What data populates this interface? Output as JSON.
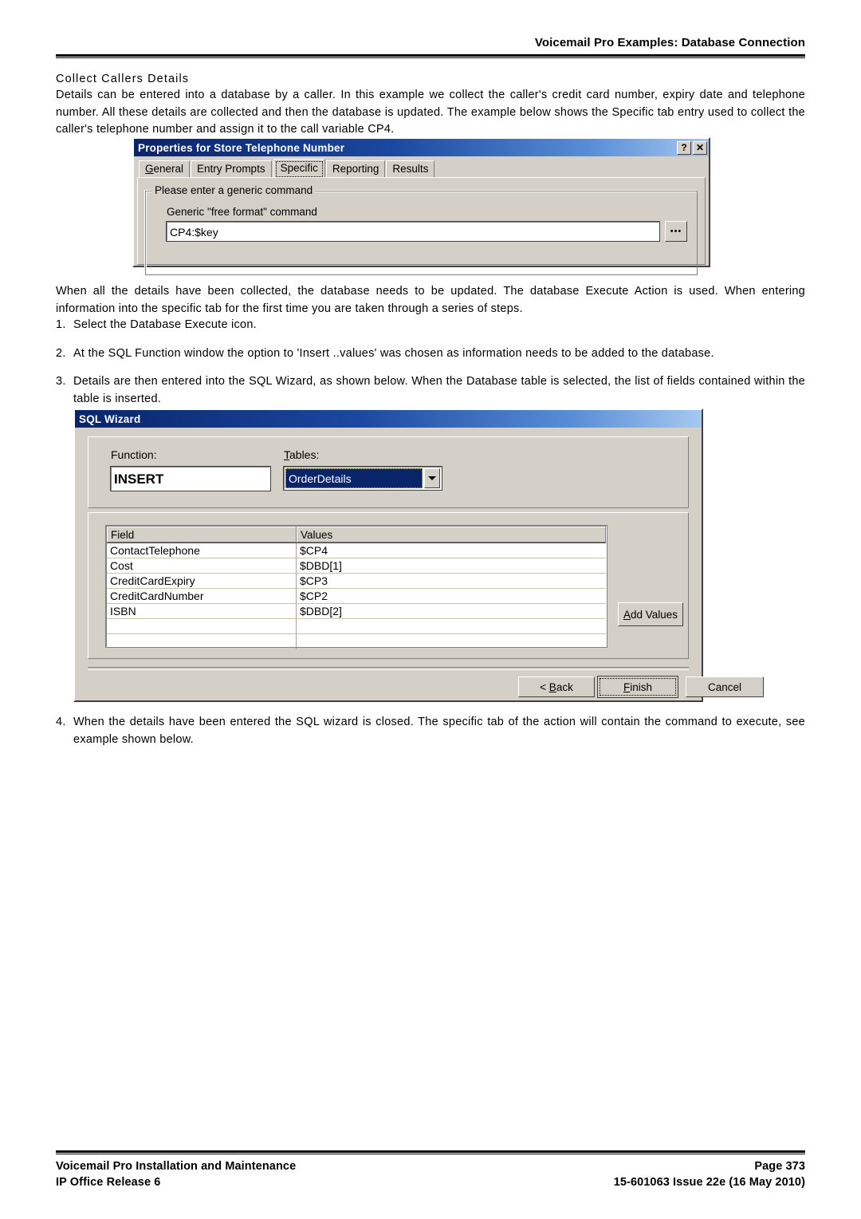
{
  "header": {
    "title": "Voicemail Pro Examples: Database Connection"
  },
  "section": {
    "heading": "Collect Callers Details",
    "intro": "Details can be entered into a database by a caller. In this example we collect the caller's credit card number, expiry date and telephone number. All these details are collected and then the database is updated. The example below shows the Specific tab entry used to collect the caller's telephone number and assign it to the call variable CP4.",
    "after_first_dialog": "When all the details have been collected, the database needs to be updated. The database Execute Action is used. When entering information into the specific tab for the first time you are taken through a series of steps.",
    "steps": [
      {
        "num": "1.",
        "text": "Select the Database Execute icon."
      },
      {
        "num": "2.",
        "text": "At the SQL Function window the option to 'Insert ..values' was chosen as information needs to be added to the database."
      },
      {
        "num": "3.",
        "text": "Details are then entered into the SQL Wizard, as shown below. When the Database table is selected, the list of fields contained within the table is inserted."
      }
    ],
    "step4": {
      "num": "4.",
      "text": "When the details have been entered the SQL wizard is closed. The specific tab of the action will contain the command to execute, see example shown below."
    }
  },
  "properties_dialog": {
    "title": "Properties for Store Telephone Number",
    "help_button": "?",
    "close_button": "✕",
    "tabs": [
      {
        "label": "General",
        "accel": "G",
        "selected": false
      },
      {
        "label": "Entry Prompts",
        "accel": "",
        "selected": false
      },
      {
        "label": "Specific",
        "accel": "",
        "selected": true
      },
      {
        "label": "Reporting",
        "accel": "g",
        "selected": false
      },
      {
        "label": "Results",
        "accel": "",
        "selected": false
      }
    ],
    "groupbox_legend": "Please enter a generic command",
    "field_label": "Generic \"free format\" command",
    "command_value": "CP4:$key",
    "browse_button": "•••"
  },
  "sql_wizard": {
    "title": "SQL Wizard",
    "function_label": "Function:",
    "function_value": "INSERT",
    "tables_label": "Tables:",
    "tables_accel": "T",
    "tables_value": "OrderDetails",
    "grid": {
      "columns": [
        "Field",
        "Values"
      ],
      "rows": [
        {
          "field": "ContactTelephone",
          "value": "$CP4"
        },
        {
          "field": "Cost",
          "value": "$DBD[1]"
        },
        {
          "field": "CreditCardExpiry",
          "value": "$CP3"
        },
        {
          "field": "CreditCardNumber",
          "value": "$CP2"
        },
        {
          "field": "ISBN",
          "value": "$DBD[2]"
        },
        {
          "field": "",
          "value": ""
        },
        {
          "field": "",
          "value": ""
        }
      ]
    },
    "add_values_button": "Add Values",
    "add_values_accel": "A",
    "buttons": {
      "back": "< Back",
      "back_accel": "B",
      "finish": "Finish",
      "finish_accel": "F",
      "cancel": "Cancel"
    }
  },
  "footer": {
    "left_line1": "Voicemail Pro Installation and Maintenance",
    "left_line2": "IP Office Release 6",
    "right_line1": "Page 373",
    "right_line2": "15-601063 Issue 22e (16 May 2010)"
  },
  "colors": {
    "titlebar_start": "#0a246a",
    "titlebar_end": "#a6c8f0",
    "dialog_face": "#d4d0c8",
    "selection": "#0a246a"
  }
}
